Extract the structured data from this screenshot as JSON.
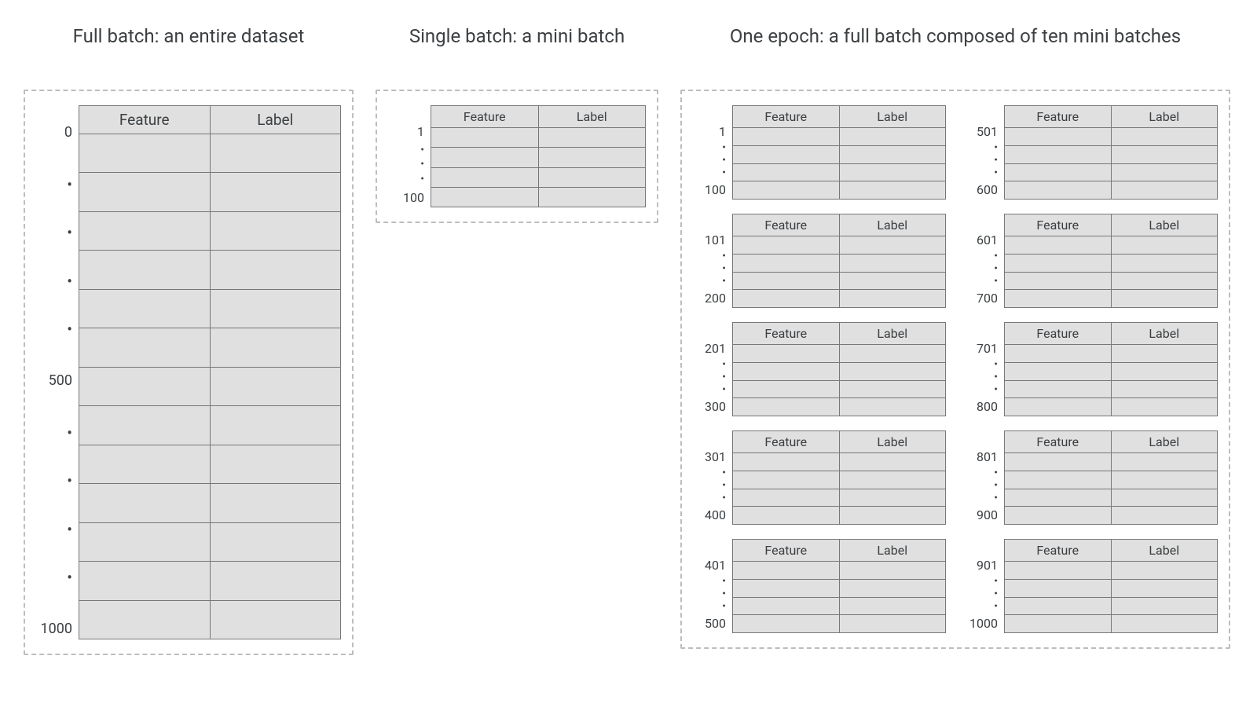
{
  "titles": {
    "full": "Full batch: an entire dataset",
    "single": "Single batch: a mini batch",
    "epoch": "One epoch: a full batch composed of ten mini batches"
  },
  "headers": {
    "feature": "Feature",
    "label": "Label"
  },
  "dot": "•",
  "full_labels": [
    "0",
    "500",
    "1000"
  ],
  "single_labels": [
    "1",
    "100"
  ],
  "mini_batches": [
    {
      "start": "1",
      "end": "100"
    },
    {
      "start": "501",
      "end": "600"
    },
    {
      "start": "101",
      "end": "200"
    },
    {
      "start": "601",
      "end": "700"
    },
    {
      "start": "201",
      "end": "300"
    },
    {
      "start": "701",
      "end": "800"
    },
    {
      "start": "301",
      "end": "400"
    },
    {
      "start": "801",
      "end": "900"
    },
    {
      "start": "401",
      "end": "500"
    },
    {
      "start": "901",
      "end": "1000"
    }
  ]
}
